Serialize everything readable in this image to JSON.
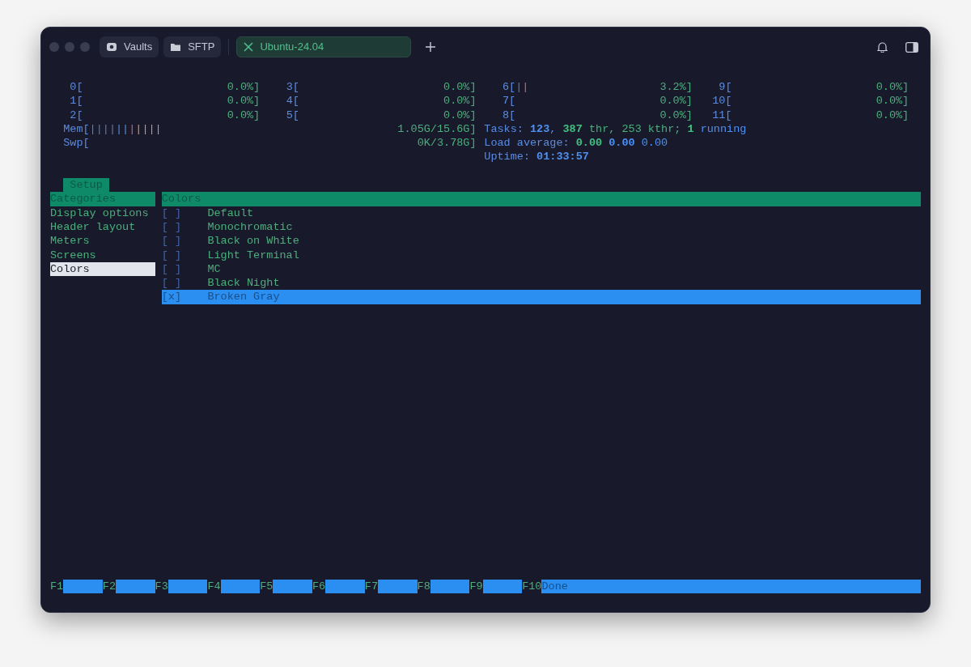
{
  "tabs": [
    {
      "label": "Vaults",
      "kind": "vault",
      "selected": false
    },
    {
      "label": "SFTP",
      "kind": "folder",
      "selected": false
    },
    {
      "label": "Ubuntu-24.04",
      "kind": "terminal",
      "selected": true
    }
  ],
  "cpu_columns": [
    [
      {
        "label": "0[",
        "reading": "0.0%]"
      },
      {
        "label": "1[",
        "reading": "0.0%]"
      },
      {
        "label": "2[",
        "reading": "0.0%]"
      }
    ],
    [
      {
        "label": "3[",
        "reading": "0.0%]"
      },
      {
        "label": "4[",
        "reading": "0.0%]"
      },
      {
        "label": "5[",
        "reading": "0.0%]"
      }
    ],
    [
      {
        "label": "6[",
        "bars": [
          {
            "text": "|",
            "kind": "low"
          },
          {
            "text": "|",
            "kind": "high"
          }
        ],
        "reading": "3.2%]"
      },
      {
        "label": "7[",
        "reading": "0.0%]"
      },
      {
        "label": "8[",
        "reading": "0.0%]"
      }
    ],
    [
      {
        "label": "9[",
        "reading": "0.0%]"
      },
      {
        "label": "10[",
        "reading": "0.0%]"
      },
      {
        "label": "11[",
        "reading": "0.0%]"
      }
    ]
  ],
  "memory": [
    {
      "label": "Mem[",
      "bars": [
        {
          "text": "||||",
          "kind": "low"
        },
        {
          "text": "||",
          "kind": "mid"
        },
        {
          "text": "|",
          "kind": "high"
        },
        {
          "text": "||||",
          "kind": "cache"
        }
      ],
      "reading": "1.05G/15.6G]"
    },
    {
      "label": "Swp[",
      "reading": "0K/3.78G]"
    }
  ],
  "info_lines": [
    [
      {
        "text": "Tasks: ",
        "kind": "label"
      },
      {
        "text": "123",
        "kind": "strong_blue"
      },
      {
        "text": ", ",
        "kind": "label"
      },
      {
        "text": "387",
        "kind": "strong_green"
      },
      {
        "text": " thr, 253 kthr; ",
        "kind": "green"
      },
      {
        "text": "1",
        "kind": "strong_green"
      },
      {
        "text": " running",
        "kind": "blue"
      }
    ],
    [
      {
        "text": "Load average: ",
        "kind": "label"
      },
      {
        "text": "0.00 ",
        "kind": "strong_green"
      },
      {
        "text": "0.00 ",
        "kind": "strong_blue"
      },
      {
        "text": "0.00",
        "kind": "blue"
      }
    ],
    [
      {
        "text": "Uptime: ",
        "kind": "label"
      },
      {
        "text": "01:33:57",
        "kind": "strong_blue"
      }
    ]
  ],
  "setup_tab": "Setup",
  "categories": {
    "title": "Categories",
    "items": [
      {
        "label": "Display options",
        "selected": false
      },
      {
        "label": "Header layout",
        "selected": false
      },
      {
        "label": "Meters",
        "selected": false
      },
      {
        "label": "Screens",
        "selected": false
      },
      {
        "label": "Colors",
        "selected": true
      }
    ]
  },
  "colors_panel": {
    "title": "Colors",
    "options": [
      {
        "box": "[ ]",
        "label": "Default",
        "selected": false
      },
      {
        "box": "[ ]",
        "label": "Monochromatic",
        "selected": false
      },
      {
        "box": "[ ]",
        "label": "Black on White",
        "selected": false
      },
      {
        "box": "[ ]",
        "label": "Light Terminal",
        "selected": false
      },
      {
        "box": "[ ]",
        "label": "MC",
        "selected": false
      },
      {
        "box": "[ ]",
        "label": "Black Night",
        "selected": false
      },
      {
        "box": "[x]",
        "label": "Broken Gray",
        "selected": true
      }
    ]
  },
  "function_keys": [
    {
      "key": "F1"
    },
    {
      "key": "F2"
    },
    {
      "key": "F3"
    },
    {
      "key": "F4"
    },
    {
      "key": "F5"
    },
    {
      "key": "F6"
    },
    {
      "key": "F7"
    },
    {
      "key": "F8"
    },
    {
      "key": "F9"
    },
    {
      "key": "F10",
      "label": "Done"
    }
  ]
}
